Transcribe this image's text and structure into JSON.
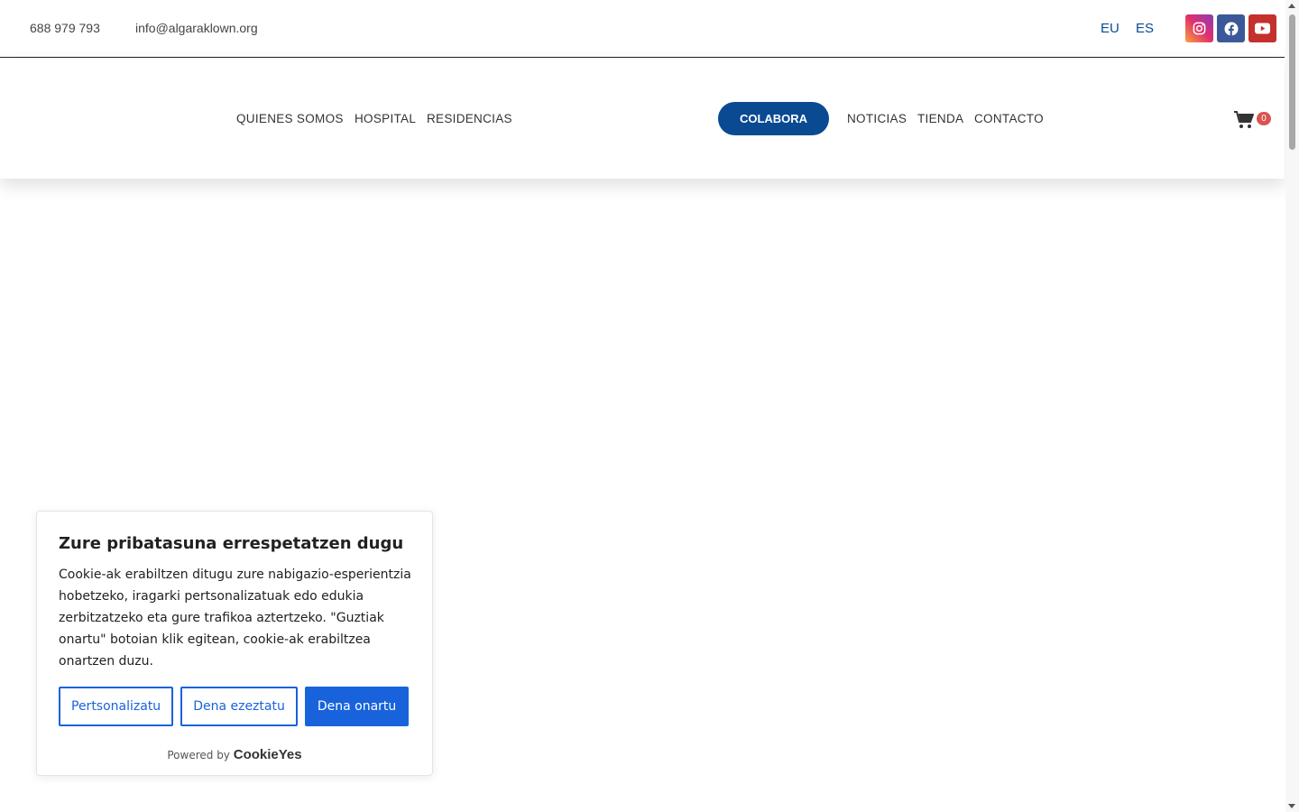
{
  "topbar": {
    "phone": "688 979 793",
    "email": "info@algaraklown.org",
    "languages": [
      "EU",
      "ES"
    ],
    "social": [
      {
        "name": "instagram-icon",
        "color": "#e1306c"
      },
      {
        "name": "facebook-icon",
        "color": "#3b5998"
      },
      {
        "name": "youtube-icon",
        "color": "#c4302b"
      }
    ]
  },
  "nav": {
    "left": [
      "QUIENES SOMOS",
      "HOSPITAL",
      "RESIDENCIAS"
    ],
    "cta": "COLABORA",
    "right": [
      "NOTICIAS",
      "TIENDA",
      "CONTACTO"
    ],
    "cart_count": "0"
  },
  "cookie": {
    "title": "Zure pribatasuna errespetatzen dugu",
    "body": "Cookie-ak erabiltzen ditugu zure nabigazio-esperientzia hobetzeko, iragarki pertsonalizatuak edo edukia zerbitzatzeko eta gure trafikoa aztertzeko. \"Guztiak onartu\" botoian klik egitean, cookie-ak erabiltzea onartzen duzu.",
    "customize_label": "Pertsonalizatu",
    "reject_label": "Dena ezeztatu",
    "accept_label": "Dena onartu",
    "powered_by": "Powered by",
    "brand": "CookieYes"
  },
  "colors": {
    "brand_blue": "#0a4a93",
    "cookie_blue": "#1863dc",
    "badge_red": "#d9534f"
  }
}
